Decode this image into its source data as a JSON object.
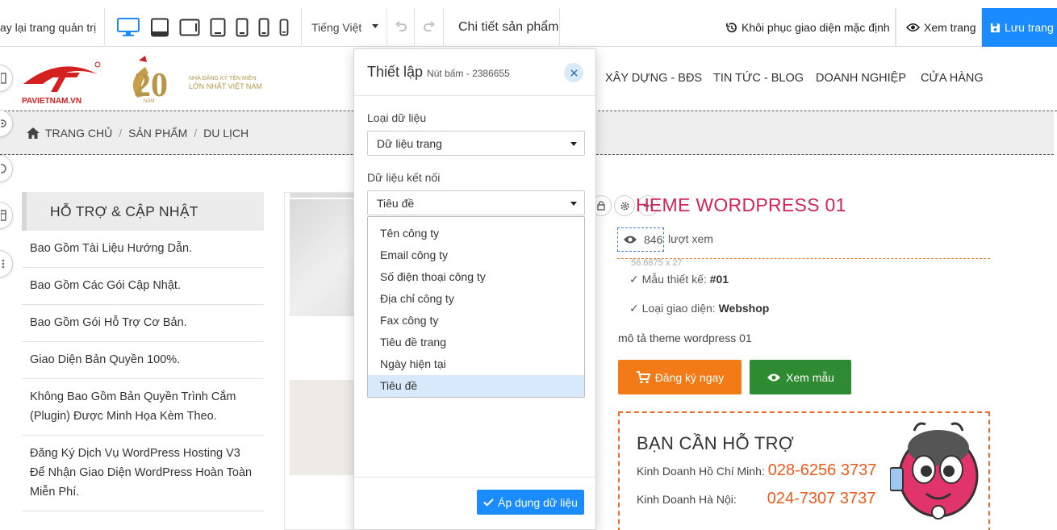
{
  "toolbar": {
    "back_label": "ay lại trang quản trị",
    "language": "Tiếng Việt",
    "page_name": "Chi tiết sản phẩm",
    "restore_label": "Khôi phục giao diện mặc định",
    "view_label": "Xem trang",
    "save_label": "Lưu trang",
    "accent_color": "#1a8cff"
  },
  "header": {
    "logo_text": "PAVIETNAM.VN",
    "badge_line1": "NHÀ ĐĂNG KÝ TÊN MIỀN",
    "badge_line2": "LỚN NHẤT VIỆT NAM",
    "badge_small": "NĂM",
    "nav": [
      "XÂY DỰNG - BĐS",
      "TIN TỨC - BLOG",
      "DOANH NGHIỆP",
      "CỬA HÀNG"
    ]
  },
  "breadcrumb": {
    "items": [
      "TRANG CHỦ",
      "SẢN PHẨM",
      "DU LỊCH"
    ]
  },
  "sidebar": {
    "title": "HỖ TRỢ & CẬP NHẬT",
    "items": [
      "Bao Gồm Tài Liệu Hướng Dẫn.",
      "Bao Gồm Các Gói Cập Nhật.",
      "Bao Gồm Gói Hỗ Trợ Cơ Bản.",
      "Giao Diện Bản Quyền 100%.",
      "Không Bao Gồm Bản Quyền Trình Cắm (Plugin) Được Minh Họa Kèm Theo.",
      "Đăng Ký Dịch Vụ WordPress Hosting V3 Để Nhận Giao Diện WordPress Hoàn Toàn Miễn Phí."
    ]
  },
  "product": {
    "title": "HEME WORDPRESS 01",
    "views_count": "846",
    "views_label": "lượt xem",
    "size_hint": "56.6875 x 27",
    "spec1_label": "Mẫu thiết kế:",
    "spec1_value": "#01",
    "spec2_label": "Loại giao diện:",
    "spec2_value": "Webshop",
    "description": "mô tả theme wordpress 01",
    "register_label": "Đăng ký ngay",
    "demo_label": "Xem mẫu",
    "register_color": "#f27a17",
    "demo_color": "#2e8b32"
  },
  "help": {
    "title": "BẠN CẦN HỖ TRỢ",
    "rows": [
      {
        "label": "Kinh Doanh Hồ Chí Minh:",
        "phone": "028-6256 3737"
      },
      {
        "label": "Kinh Doanh Hà Nội:",
        "phone": "024-7307 3737"
      }
    ]
  },
  "popup": {
    "title": "Thiết lập",
    "subtitle": "Nút bấm - 2386655",
    "data_type_label": "Loại dữ liệu",
    "data_type_value": "Dữ liệu trang",
    "data_link_label": "Dữ liệu kết nối",
    "data_link_value": "Tiêu đề",
    "options": [
      "Tên công ty",
      "Email công ty",
      "Số điện thoại công ty",
      "Địa chỉ công ty",
      "Fax công ty",
      "Tiêu đề trang",
      "Ngày hiện tại",
      "Tiêu đề"
    ],
    "selected_index": 7,
    "apply_label": "Áp dụng dữ liệu"
  }
}
